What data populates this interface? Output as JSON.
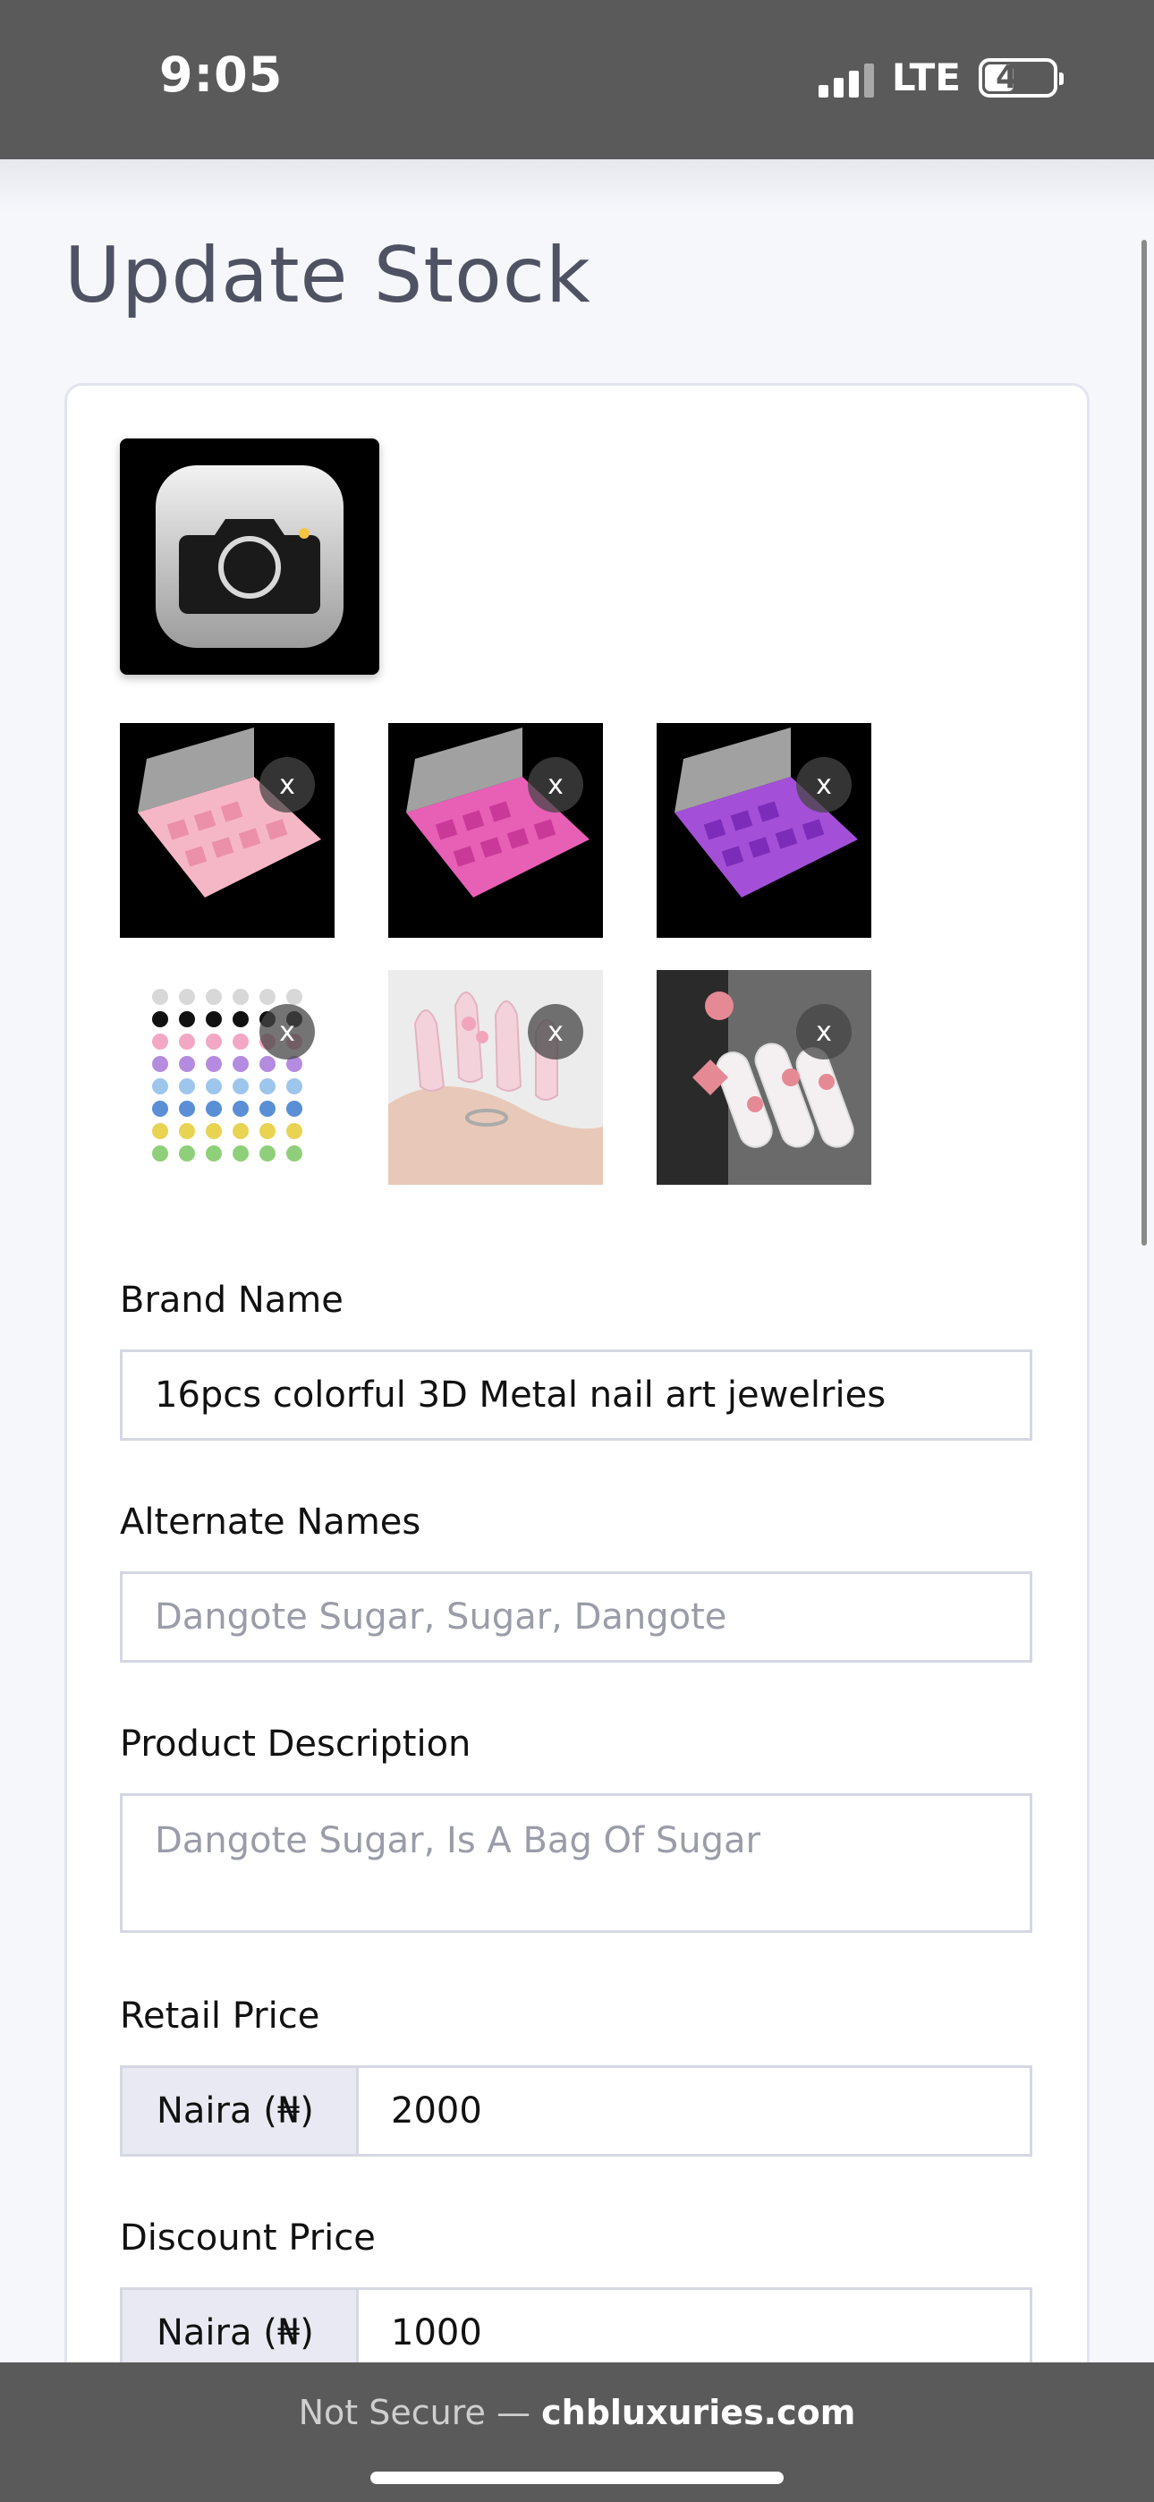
{
  "status": {
    "time": "9:05",
    "network": "LTE",
    "battery": "41"
  },
  "page": {
    "title": "Update Stock"
  },
  "images": {
    "upload_icon": "camera-icon",
    "remove_label": "x",
    "thumbnails": [
      {
        "name": "pink-organizer-box"
      },
      {
        "name": "magenta-organizer-box"
      },
      {
        "name": "purple-organizer-box"
      },
      {
        "name": "nail-charm-chart"
      },
      {
        "name": "pink-manicure-hand"
      },
      {
        "name": "pink-nail-art-closeup"
      }
    ]
  },
  "form": {
    "brand_name": {
      "label": "Brand Name",
      "value": "16pcs colorful 3D Metal nail art jewelries"
    },
    "alternate_names": {
      "label": "Alternate Names",
      "placeholder": "Dangote Sugar, Sugar, Dangote"
    },
    "description": {
      "label": "Product Description",
      "placeholder": "Dangote Sugar, Is A Bag Of Sugar"
    },
    "retail_price": {
      "label": "Retail Price",
      "currency": "Naira (₦)",
      "value": "2000"
    },
    "discount_price": {
      "label": "Discount Price",
      "currency": "Naira (₦)",
      "value": "1000"
    }
  },
  "browser": {
    "security": "Not Secure —",
    "domain": "chbluxuries.com"
  }
}
